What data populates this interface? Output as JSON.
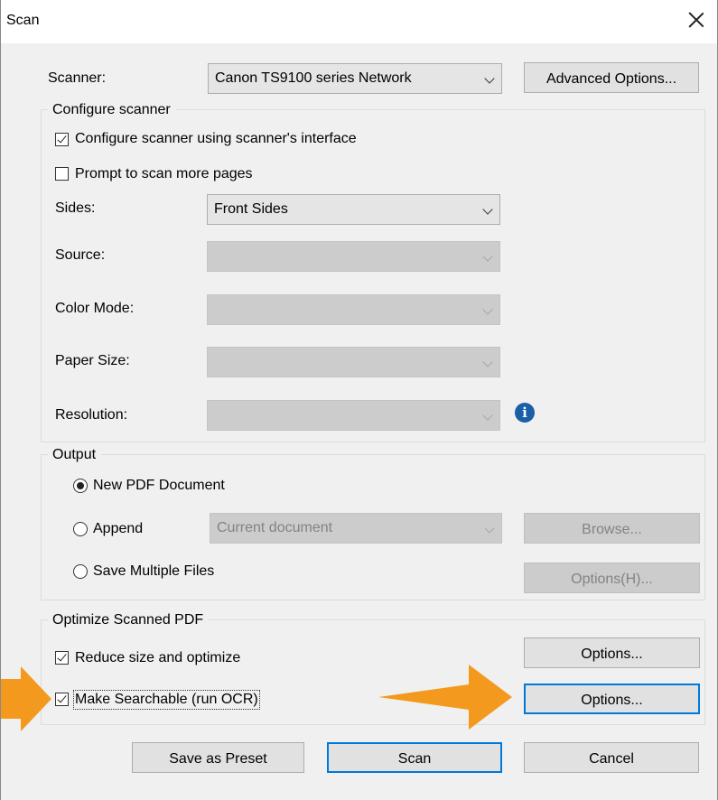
{
  "window": {
    "title": "Scan"
  },
  "scanner": {
    "label": "Scanner:",
    "selected": "Canon TS9100 series Network",
    "advanced_button": "Advanced Options..."
  },
  "configure": {
    "group_title": "Configure scanner",
    "use_interface": {
      "label": "Configure scanner using scanner's interface",
      "checked": true
    },
    "prompt_more": {
      "label": "Prompt to scan more pages",
      "checked": false
    },
    "sides": {
      "label": "Sides:",
      "value": "Front Sides"
    },
    "source": {
      "label": "Source:",
      "value": ""
    },
    "color_mode": {
      "label": "Color Mode:",
      "value": ""
    },
    "paper_size": {
      "label": "Paper Size:",
      "value": ""
    },
    "resolution": {
      "label": "Resolution:",
      "value": ""
    },
    "info_icon": "info-icon"
  },
  "output": {
    "group_title": "Output",
    "new_pdf": {
      "label": "New PDF Document",
      "selected": true
    },
    "append": {
      "label": "Append",
      "selected": false,
      "combo_value": "Current document",
      "browse_button": "Browse..."
    },
    "save_multiple": {
      "label": "Save Multiple Files",
      "selected": false,
      "options_button": "Options(H)..."
    }
  },
  "optimize": {
    "group_title": "Optimize Scanned PDF",
    "reduce": {
      "label": "Reduce size and optimize",
      "checked": true,
      "options_button": "Options..."
    },
    "ocr": {
      "label": "Make Searchable (run OCR)",
      "checked": true,
      "options_button": "Options..."
    }
  },
  "footer": {
    "save_preset": "Save as Preset",
    "scan": "Scan",
    "cancel": "Cancel"
  },
  "colors": {
    "accent": "#0078d7",
    "annotation_arrow": "#f39a1e"
  }
}
